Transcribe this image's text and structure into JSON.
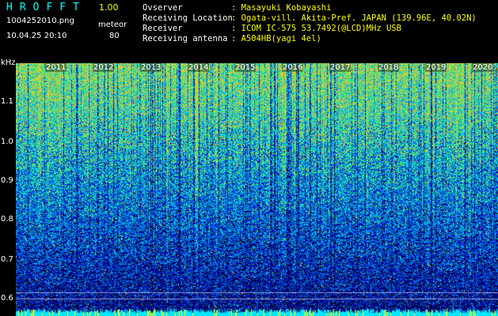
{
  "header": {
    "app_title": "HROFFT",
    "version": "1.00",
    "filename": "1004252010.png",
    "datetime": "10.04.25 20:10",
    "mode": "meteor",
    "count": "80"
  },
  "info": [
    {
      "label": "Ovserver",
      "value": ": Masayuki Kobayashi"
    },
    {
      "label": "Receiving Location",
      "value": ": Ogata-vill. Akita-Pref. JAPAN (139.96E, 40.02N)"
    },
    {
      "label": "Receiver",
      "value": ": ICOM IC-575 53.7492(@LCD)MHz USB"
    },
    {
      "label": "Receiving antenna",
      "value": ": A504HB(yagi 4el)"
    }
  ],
  "axis": {
    "unit": "kHz",
    "y_ticks": [
      "1.1",
      "1.0",
      "0.9",
      "0.8",
      "0.7",
      "0.6"
    ],
    "x_ticks": [
      "2011",
      "2012",
      "2013",
      "2014",
      "2015",
      "2016",
      "2017",
      "2018",
      "2019",
      "2020"
    ]
  },
  "colors": {
    "title": "#00ffff",
    "value": "#ffff00",
    "label": "#ffffff",
    "background": "#000000"
  }
}
